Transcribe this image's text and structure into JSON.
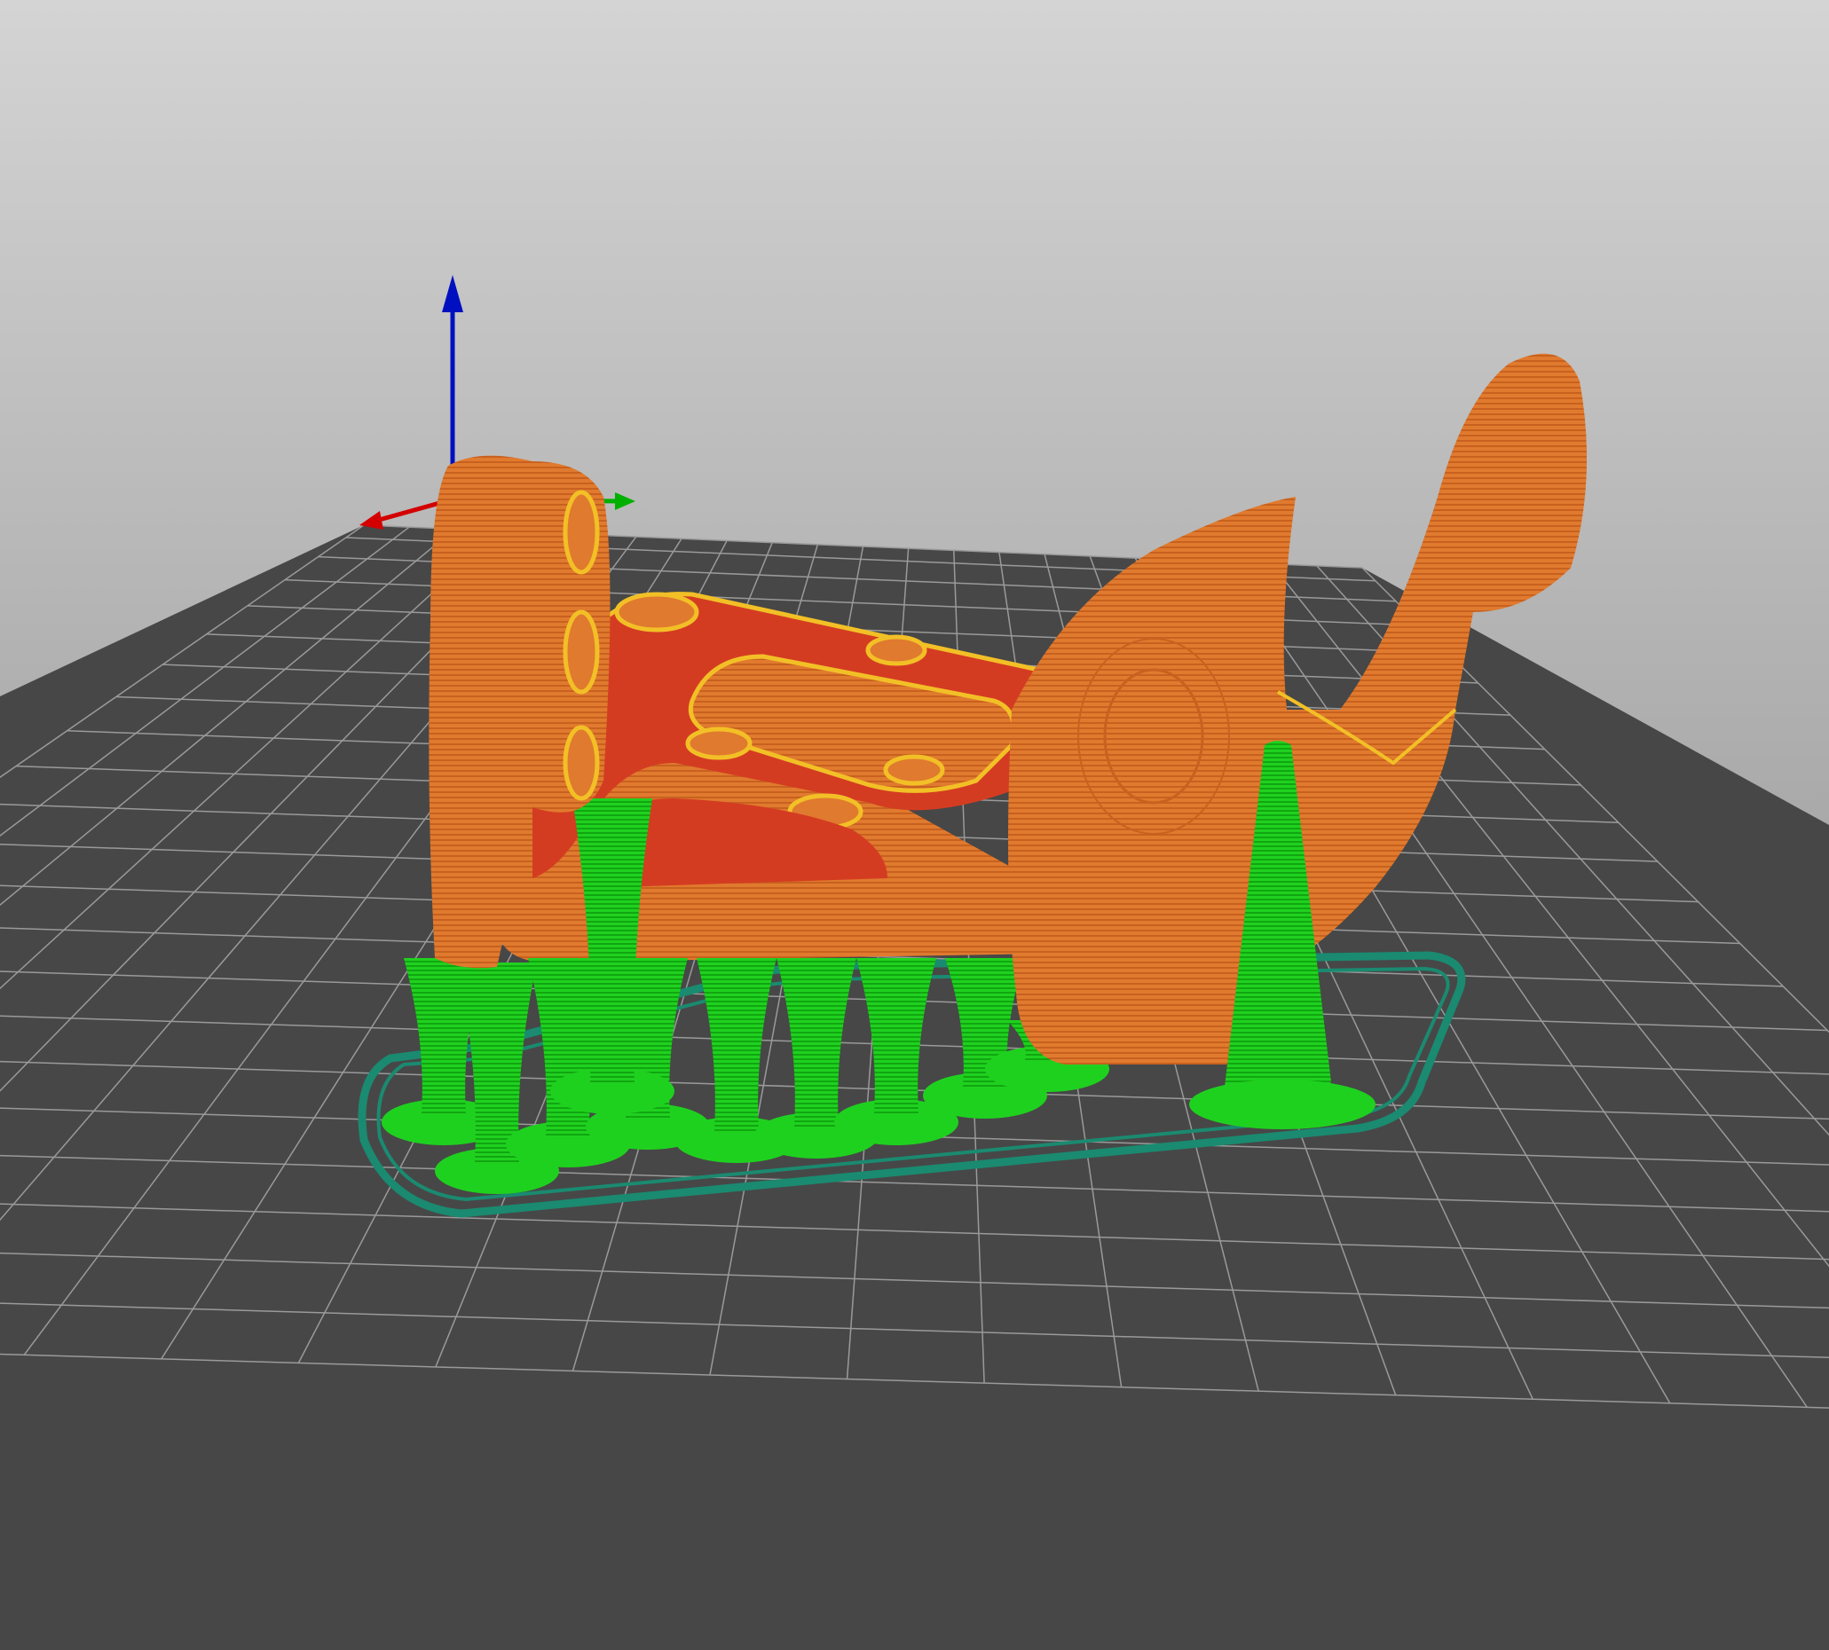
{
  "viewport": {
    "background_top": "#d4d4d4",
    "background_bottom": "#7e7e7e",
    "bed_color": "#474747",
    "grid_color": "#9a9a9a"
  },
  "axes": {
    "x_color": "#d40000",
    "y_color": "#00b000",
    "z_color": "#0010c0"
  },
  "model": {
    "perimeter_color": "#e07a2e",
    "perimeter_dark": "#c8611f",
    "solid_infill_color": "#d43c22",
    "outer_wall_color": "#f2c026",
    "support_color": "#1fd11f",
    "support_dark": "#11a611",
    "skirt_color": "#1a8a70"
  }
}
